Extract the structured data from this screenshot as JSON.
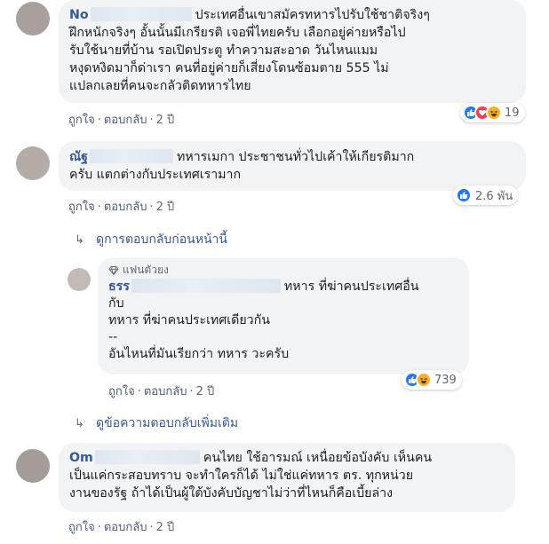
{
  "comments": [
    {
      "name": "No",
      "lines": [
        "ประเทศอื่นเขาสมัครทหารไปรับใช้ชาติจริงๆ",
        "ฝึกหนักจริงๆ อั้นนั้นมีเกรียรติ เจอพี่ไทยครับ เลือกอยู่ค่ายหรือไป",
        "รับใช้นายที่บ้าน รอเปิดประตู ทำความสะอาด วันไหนแมม",
        "หงุดหงิดมาก็ด่าเรา คนที่อยู่ค่ายก็เสี่ยงโดนซ้อมตาย 555 ไม่",
        "แปลกเลยที่คนจะกลัวติดทหารไทย"
      ],
      "like": "ถูกใจ",
      "reply": "ตอบกลับ",
      "time": "2 ปี",
      "reaction_count": "19",
      "reactions": [
        "like-icon",
        "love-icon",
        "haha-icon"
      ]
    },
    {
      "name": "ณัฐ",
      "lines": [
        "ทหารเมกา ประชาชนทั่วไปเค้าให้เกียรติมาก",
        "ครับ แตกต่างกับประเทศเรามาก"
      ],
      "like": "ถูกใจ",
      "reply": "ตอบกลับ",
      "time": "2 ปี",
      "reaction_count": "2.6 พัน",
      "reactions": [
        "like-icon"
      ]
    },
    {
      "name": "Om",
      "lines": [
        "คนไทย ใช้อารมณ์ เหนื่อยข้อบังคับ เห็นคน",
        "เป็นแค่กระสอบทราบ จะทำใครก็ได้ ไม่ใช่แค่ทหาร ตร. ทุกหน่วย",
        "งานของรัฐ ถ้าได้เป็นผู้ใต้บังคับบัญชาไม่ว่าที่ไหนก็คือเบี้ยล่าง"
      ],
      "like": "ถูกใจ",
      "reply": "ตอบกลับ",
      "time": "2 ปี"
    }
  ],
  "view_previous_replies": "ดูการตอบกลับก่อนหน้านี้",
  "reply": {
    "badge": "แฟนตัวยง",
    "name": "ธรร",
    "lines": [
      "ทหาร ที่ฆ่าคนประเทศอื่น",
      "กับ",
      "ทหาร ที่ฆ่าคนประเทศเดียวกัน",
      "--",
      "อันไหนที่มันเรียกว่า ทหาร วะครับ"
    ],
    "like": "ถูกใจ",
    "reply": "ตอบกลับ",
    "time": "2 ปี",
    "reaction_count": "739",
    "reactions": [
      "like-icon",
      "haha-icon"
    ]
  },
  "view_more_replies": "ดูข้อความตอบกลับเพิ่มเติม",
  "colors": {
    "name_link": "#385898",
    "bubble": "#f2f3f5",
    "like": "#2078f4",
    "love": "#f33e58",
    "haha": "#f7b125"
  }
}
